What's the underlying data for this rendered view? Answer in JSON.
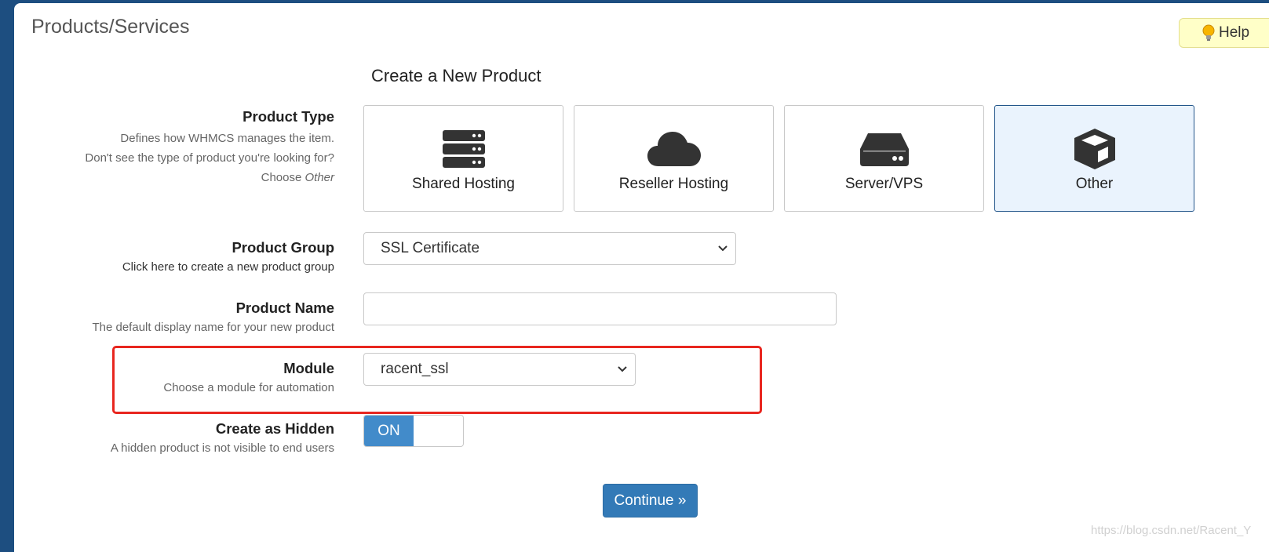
{
  "page": {
    "title": "Products/Services",
    "help_label": "Help"
  },
  "form": {
    "section_title": "Create a New Product",
    "product_type": {
      "label": "Product Type",
      "desc_line1": "Defines how WHMCS manages the item.",
      "desc_line2": "Don't see the type of product you're looking for?",
      "desc_line3_prefix": "Choose ",
      "desc_line3_em": "Other",
      "options": [
        {
          "label": "Shared Hosting",
          "icon": "server-stack-icon",
          "selected": false
        },
        {
          "label": "Reseller Hosting",
          "icon": "cloud-icon",
          "selected": false
        },
        {
          "label": "Server/VPS",
          "icon": "hard-drive-icon",
          "selected": false
        },
        {
          "label": "Other",
          "icon": "cube-icon",
          "selected": true
        }
      ]
    },
    "product_group": {
      "label": "Product Group",
      "link": "Click here to create a new product group",
      "value": "SSL Certificate"
    },
    "product_name": {
      "label": "Product Name",
      "desc": "The default display name for your new product",
      "value": ""
    },
    "module": {
      "label": "Module",
      "desc": "Choose a module for automation",
      "value": "racent_ssl"
    },
    "create_hidden": {
      "label": "Create as Hidden",
      "desc": "A hidden product is not visible to end users",
      "state": "ON"
    },
    "continue_label": "Continue »"
  },
  "watermark": "https://blog.csdn.net/Racent_Y",
  "colors": {
    "sidebar": "#1d4e80",
    "primary": "#337ab7",
    "toggle_on": "#428bca",
    "highlight": "#e8261f",
    "selected_card_bg": "#eaf3fd"
  }
}
